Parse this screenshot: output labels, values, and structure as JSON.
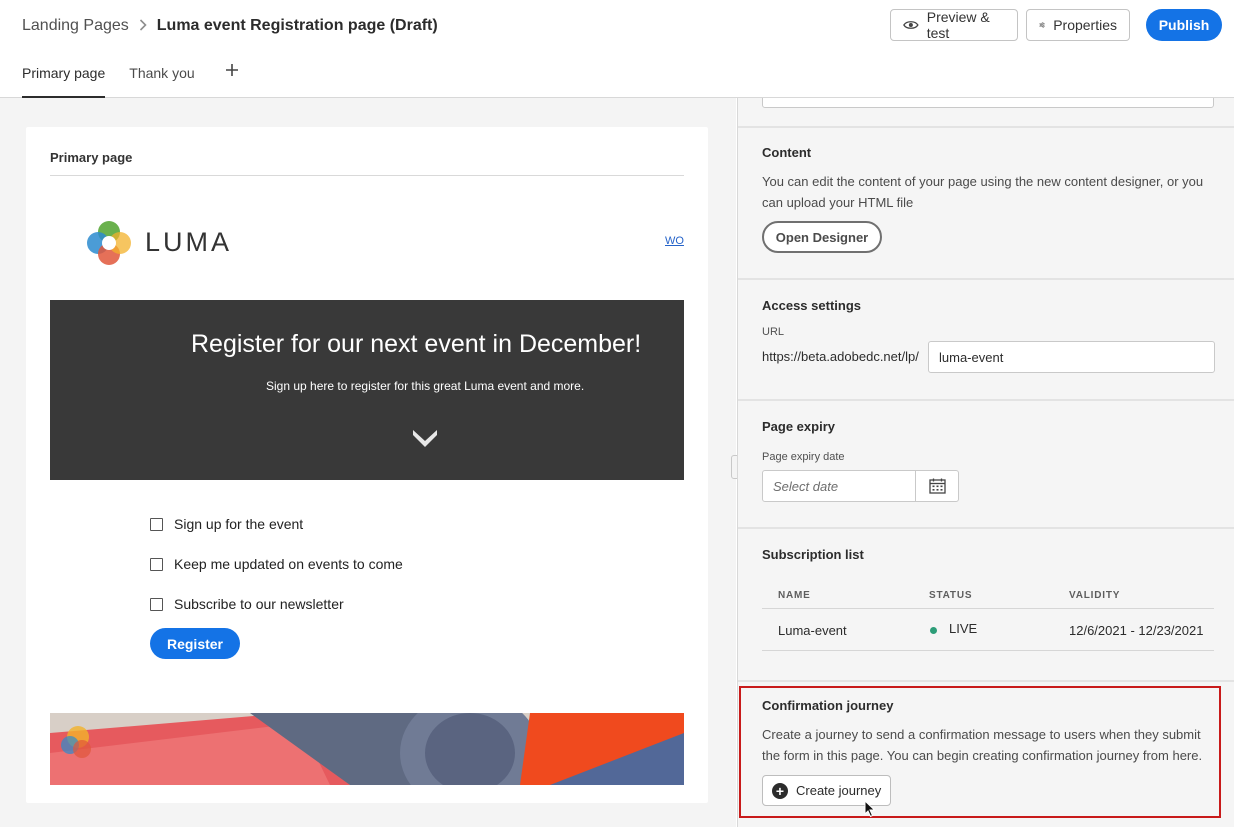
{
  "header": {
    "breadcrumb_parent": "Landing Pages",
    "title": "Luma event Registration page (Draft)",
    "preview_label": "Preview & test",
    "properties_label": "Properties",
    "publish_label": "Publish",
    "accent_color": "#1473e6"
  },
  "tabs": [
    {
      "label": "Primary page",
      "active": true
    },
    {
      "label": "Thank you",
      "active": false
    }
  ],
  "canvas": {
    "card_title": "Primary page",
    "logo_text": "LUMA",
    "nav_link": "WO",
    "hero_title": "Register for our next event in December!",
    "hero_subtitle": "Sign up here to register for this great Luma event and more.",
    "checkboxes": [
      "Sign up for the event",
      "Keep me updated on events to come",
      "Subscribe to our newsletter"
    ],
    "register_label": "Register"
  },
  "panel": {
    "content": {
      "title": "Content",
      "description": "You can edit the content of your page using the new content designer, or you can upload your HTML file",
      "button": "Open Designer"
    },
    "access": {
      "title": "Access settings",
      "url_label": "URL",
      "url_prefix": "https://beta.adobedc.net/lp/",
      "url_value": "luma-event"
    },
    "expiry": {
      "title": "Page expiry",
      "label": "Page expiry date",
      "placeholder": "Select date"
    },
    "subscription": {
      "title": "Subscription list",
      "columns": [
        "NAME",
        "STATUS",
        "VALIDITY"
      ],
      "rows": [
        {
          "name": "Luma-event",
          "status": "LIVE",
          "validity": "12/6/2021 - 12/23/2021",
          "status_color": "#2d9d78"
        }
      ]
    },
    "journey": {
      "title": "Confirmation journey",
      "description": "Create a journey to send a confirmation message to users when they submit the form in this page. You can begin creating confirmation journey from here.",
      "button": "Create journey",
      "highlight_color": "#c81a1a"
    }
  }
}
